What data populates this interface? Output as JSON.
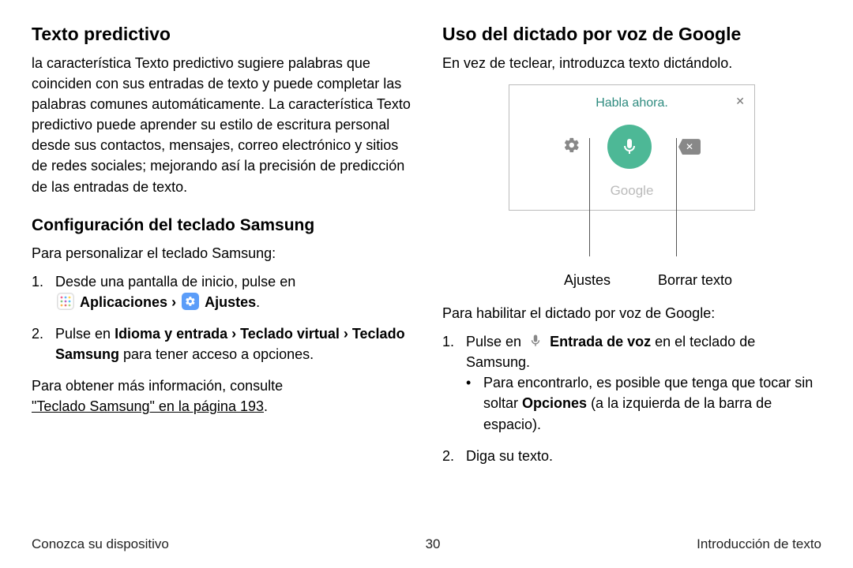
{
  "left": {
    "h2": "Texto predictivo",
    "para1": "la característica Texto predictivo sugiere palabras que coinciden con sus entradas de texto y puede completar las palabras comunes automáticamente. La característica Texto predictivo puede aprender su estilo de escritura personal desde sus contactos, mensajes, correo electrónico y sitios de redes sociales; mejorando así la precisión de predicción de las entradas de texto.",
    "h3": "Configuración del teclado Samsung",
    "para2": "Para personalizar el teclado Samsung:",
    "step1_a": "Desde una pantalla de inicio, pulse en",
    "step1_apps": "Aplicaciones",
    "step1_sep": "›",
    "step1_settings": "Ajustes",
    "step1_period": ".",
    "step2_a": "Pulse en ",
    "step2_b": "Idioma y entrada",
    "step2_c": "Teclado virtual",
    "step2_d": "Teclado Samsung",
    "step2_e": " para tener acceso a opciones.",
    "para3": "Para obtener más información, consulte ",
    "link": "\"Teclado Samsung\" en la página 193",
    "para3_end": "."
  },
  "right": {
    "h2": "Uso del dictado por voz de Google",
    "para1": "En vez de teclear, introduzca texto dictándolo.",
    "speak_now": "Habla ahora.",
    "google": "Google",
    "label_settings": "Ajustes",
    "label_delete": "Borrar texto",
    "para2": "Para habilitar el dictado por voz de Google:",
    "step1_a": "Pulse en ",
    "step1_b": "Entrada de voz",
    "step1_c": " en el teclado de Samsung.",
    "bullet_a": "Para encontrarlo, es posible que tenga que tocar sin soltar ",
    "bullet_b": "Opciones",
    "bullet_c": " (a la izquierda de la barra de espacio).",
    "step2": "Diga su texto."
  },
  "footer": {
    "left": "Conozca su dispositivo",
    "center": "30",
    "right": "Introducción de texto"
  }
}
